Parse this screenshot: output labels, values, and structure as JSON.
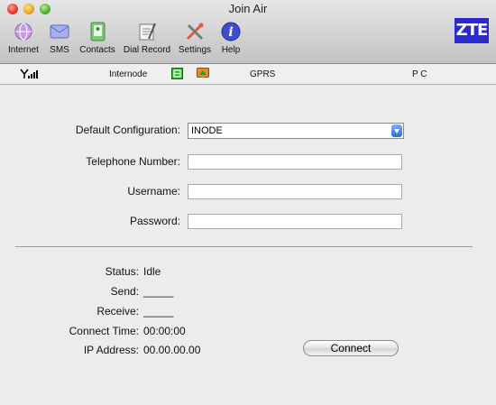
{
  "window": {
    "title": "Join Air"
  },
  "toolbar": {
    "items": [
      {
        "label": "Internet",
        "icon": "internet-globe-icon",
        "color": "#c89de0"
      },
      {
        "label": "SMS",
        "icon": "sms-envelope-icon",
        "color": "#9aa6e6"
      },
      {
        "label": "Contacts",
        "icon": "contacts-book-icon",
        "color": "#6fbf6a"
      },
      {
        "label": "Dial Record",
        "icon": "dial-record-notepad-icon",
        "color": "#cfcfcf"
      },
      {
        "label": "Settings",
        "icon": "settings-tools-icon",
        "color": "#e05a3a"
      },
      {
        "label": "Help",
        "icon": "help-info-icon",
        "color": "#3a4fd0"
      }
    ],
    "logo": "ZTE"
  },
  "statusbar": {
    "signal_icon": "signal-strength-icon",
    "operator": "Internode",
    "roaming_icon": "network-status-icon",
    "message_icon": "message-status-icon",
    "network": "GPRS",
    "mode": "P C"
  },
  "form": {
    "default_config_label": "Default Configuration:",
    "default_config_value": "INODE",
    "telephone_label": "Telephone Number:",
    "telephone_value": "",
    "username_label": "Username:",
    "username_value": "",
    "password_label": "Password:",
    "password_value": ""
  },
  "info": {
    "status_label": "Status:",
    "status_value": "Idle",
    "send_label": "Send:",
    "send_value": "_____",
    "receive_label": "Receive:",
    "receive_value": "_____",
    "connect_time_label": "Connect Time:",
    "connect_time_value": "00:00:00",
    "ip_label": "IP Address:",
    "ip_value": "00.00.00.00"
  },
  "buttons": {
    "connect": "Connect"
  }
}
